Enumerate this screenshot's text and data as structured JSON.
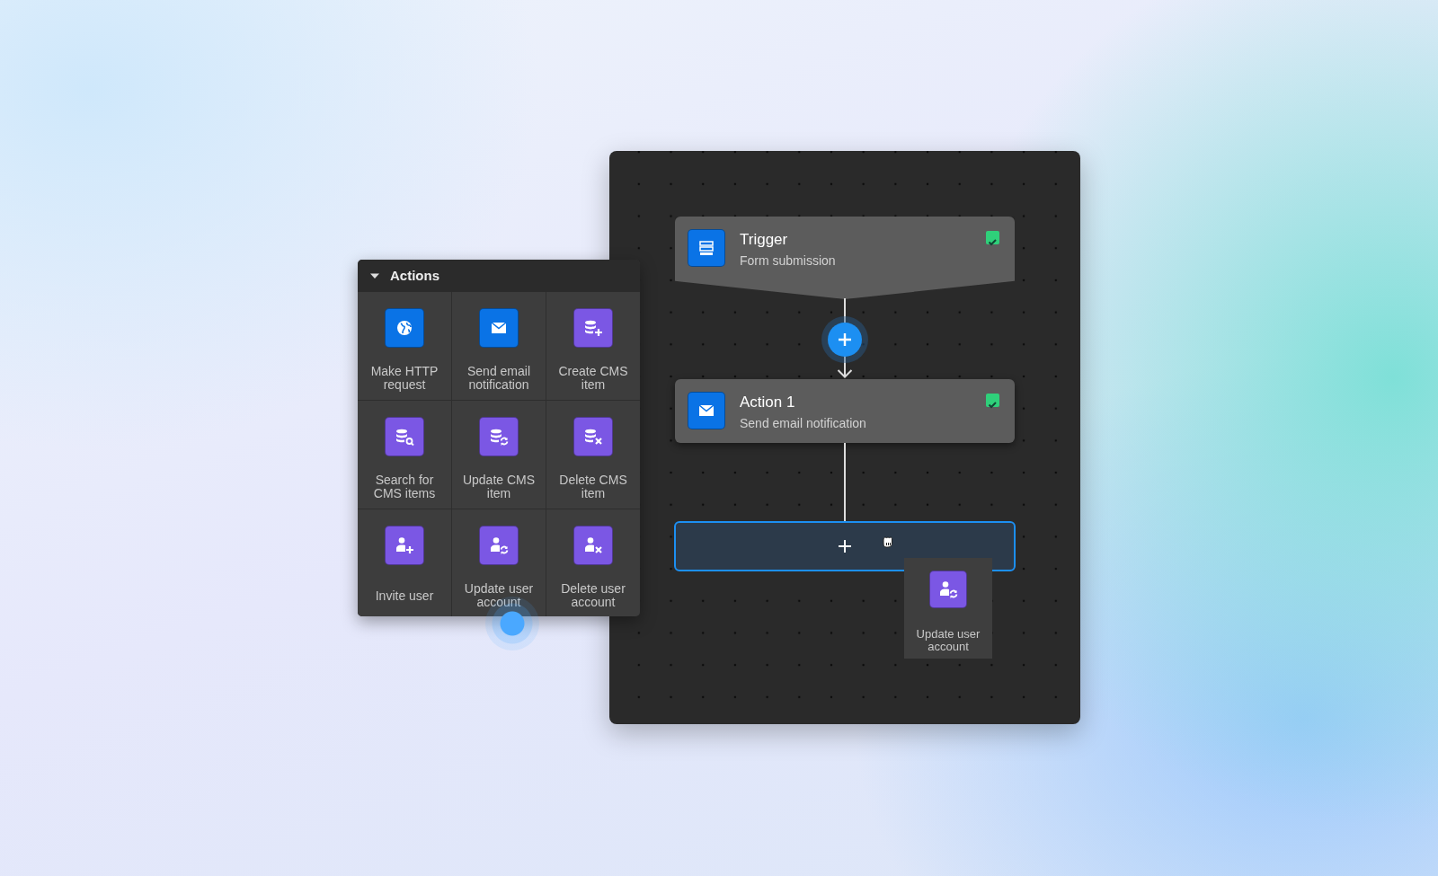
{
  "actions_panel": {
    "title": "Actions",
    "expanded": true,
    "items": [
      {
        "label": "Make HTTP request",
        "color": "#0a73e6"
      },
      {
        "label": "Send email notification",
        "color": "#0a73e6"
      },
      {
        "label": "Create CMS item",
        "color": "#7b57e4"
      },
      {
        "label": "Search for CMS items",
        "color": "#7b57e4"
      },
      {
        "label": "Update CMS item",
        "color": "#7b57e4"
      },
      {
        "label": "Delete CMS item",
        "color": "#7b57e4"
      },
      {
        "label": "Invite user",
        "color": "#7b57e4"
      },
      {
        "label": "Update user account",
        "color": "#7b57e4"
      },
      {
        "label": "Delete user account",
        "color": "#7b57e4"
      }
    ]
  },
  "flow": {
    "nodes": [
      {
        "kind": "trigger",
        "title": "Trigger",
        "subtitle": "Form submission",
        "checked": true
      },
      {
        "kind": "action",
        "title": "Action 1",
        "subtitle": "Send email notification",
        "checked": true
      }
    ],
    "drop_zone": {
      "highlighted": true
    },
    "dragged_item": {
      "label": "Update user account",
      "color": "#7b57e4"
    }
  }
}
